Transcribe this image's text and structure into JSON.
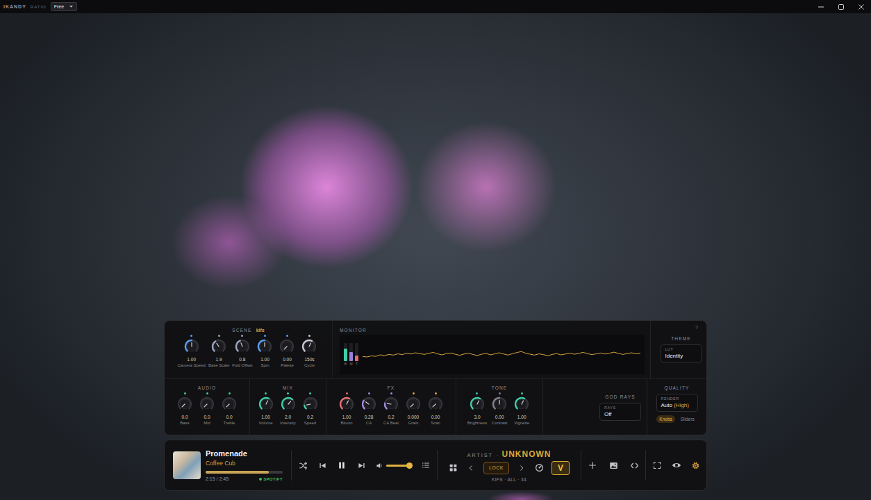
{
  "window": {
    "brand": "IKANDY",
    "edition": "RATIO",
    "plan": "Free"
  },
  "panel": {
    "help": "?",
    "scene": {
      "label": "SCENE",
      "name": "kifs",
      "knobs": [
        {
          "label": "Camera Speed",
          "value": "1.00",
          "level": 0.5,
          "color": "#5b9cf0"
        },
        {
          "label": "Base Scale",
          "value": "1.9",
          "level": 0.38,
          "color": "#9aa6bd"
        },
        {
          "label": "Fold Offset",
          "value": "0.8",
          "level": 0.42,
          "color": "#9aa6bd"
        },
        {
          "label": "Spin",
          "value": "1.00",
          "level": 0.5,
          "color": "#5b9cf0"
        },
        {
          "label": "Palette",
          "value": "0.00",
          "level": 0,
          "color": "#5b9cf0"
        },
        {
          "label": "Cycle",
          "value": "150s",
          "level": 0.6,
          "color": "#c9ccd6"
        }
      ]
    },
    "monitor": {
      "label": "MONITOR",
      "meters": [
        {
          "label": "B",
          "level": 0.7,
          "color": "#3ecfa8"
        },
        {
          "label": "M",
          "level": 0.5,
          "color": "#9b7fe0"
        },
        {
          "label": "T",
          "level": 0.3,
          "color": "#e86a6a"
        }
      ],
      "waveform": [
        0.42,
        0.4,
        0.45,
        0.43,
        0.5,
        0.47,
        0.52,
        0.49,
        0.55,
        0.51,
        0.58,
        0.54,
        0.6,
        0.56,
        0.52,
        0.57,
        0.62,
        0.55,
        0.5,
        0.56,
        0.59,
        0.53,
        0.48,
        0.54,
        0.58,
        0.52,
        0.47,
        0.53,
        0.57,
        0.5,
        0.55,
        0.6,
        0.54,
        0.49,
        0.56,
        0.61,
        0.66,
        0.58,
        0.53,
        0.49,
        0.55,
        0.51,
        0.46,
        0.52,
        0.56,
        0.5,
        0.54,
        0.58,
        0.53,
        0.57,
        0.62,
        0.56,
        0.51,
        0.55,
        0.59,
        0.54,
        0.58,
        0.63,
        0.57,
        0.52,
        0.56,
        0.6,
        0.55,
        0.58
      ]
    },
    "theme": {
      "label": "THEME",
      "field_label": "LUT",
      "value": "Identity"
    },
    "groups": [
      {
        "label": "AUDIO",
        "knobs": [
          {
            "label": "Bass",
            "value": "0.0",
            "level": 0,
            "color": "#3ecf8e"
          },
          {
            "label": "Mid",
            "value": "0.0",
            "level": 0,
            "color": "#3ecf8e"
          },
          {
            "label": "Treble",
            "value": "0.0",
            "level": 0,
            "color": "#3ecf8e"
          }
        ]
      },
      {
        "label": "MIX",
        "knobs": [
          {
            "label": "Volume",
            "value": "1.00",
            "level": 0.6,
            "color": "#3ecfa8"
          },
          {
            "label": "Intensity",
            "value": "2.0",
            "level": 0.65,
            "color": "#3ecfa8"
          },
          {
            "label": "Speed",
            "value": "0.2",
            "level": 0.12,
            "color": "#3ecfa8"
          }
        ]
      },
      {
        "label": "FX",
        "knobs": [
          {
            "label": "Bloom",
            "value": "1.00",
            "level": 0.6,
            "color": "#e8706f"
          },
          {
            "label": "CA",
            "value": "0.28",
            "level": 0.3,
            "color": "#a48be0"
          },
          {
            "label": "CA Beat",
            "value": "0.2",
            "level": 0.2,
            "color": "#a48be0"
          },
          {
            "label": "Grain",
            "value": "0.000",
            "level": 0,
            "color": "#e8a040"
          },
          {
            "label": "Scan",
            "value": "0.00",
            "level": 0,
            "color": "#e8a040"
          }
        ]
      },
      {
        "label": "TONE",
        "knobs": [
          {
            "label": "Brightness",
            "value": "3.0",
            "level": 0.6,
            "color": "#3ecfa8"
          },
          {
            "label": "Contrast",
            "value": "0.00",
            "level": 0.5,
            "color": "#7d828c"
          },
          {
            "label": "Vignette",
            "value": "1.00",
            "level": 0.6,
            "color": "#3ecfa8"
          }
        ]
      }
    ],
    "god_rays": {
      "label": "GOD RAYS",
      "field_label": "RAYS",
      "value": "Off"
    },
    "quality": {
      "label": "QUALITY",
      "field_label": "RENDER",
      "value": "Auto",
      "detail": "(High)",
      "modes": [
        {
          "label": "Knobs",
          "selected": true
        },
        {
          "label": "Sliders",
          "selected": false
        }
      ]
    }
  },
  "player": {
    "title": "Promenade",
    "artist": "Coffee Cub",
    "progress": 0.82,
    "time": "2:15 / 2:45",
    "source": "SPOTIFY",
    "playing": true,
    "volume": 0.92
  },
  "navigator": {
    "label": "ARTIST",
    "separator": "·",
    "value": "UNKNOWN",
    "lock": {
      "label": "LOCK",
      "on": false
    },
    "vj": {
      "label": "V",
      "on": true
    },
    "status": "KIFS · ALL · 34"
  }
}
